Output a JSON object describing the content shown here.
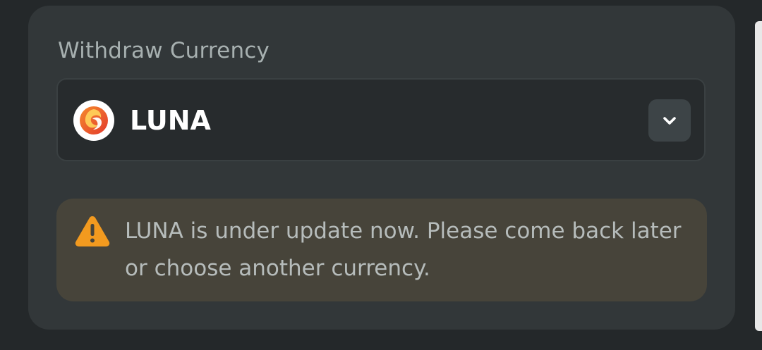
{
  "withdraw": {
    "label": "Withdraw Currency",
    "selected_currency": "LUNA",
    "currency_icon": "luna-coin-icon",
    "dropdown_icon": "chevron-down-icon"
  },
  "alert": {
    "icon": "warning-icon",
    "message": "LUNA is under update now. Please come back later or choose another currency.",
    "color": "#f29a1f"
  },
  "colors": {
    "background": "#24282a",
    "card": "#323739",
    "select": "#272b2d",
    "alert_background": "#47443a"
  }
}
